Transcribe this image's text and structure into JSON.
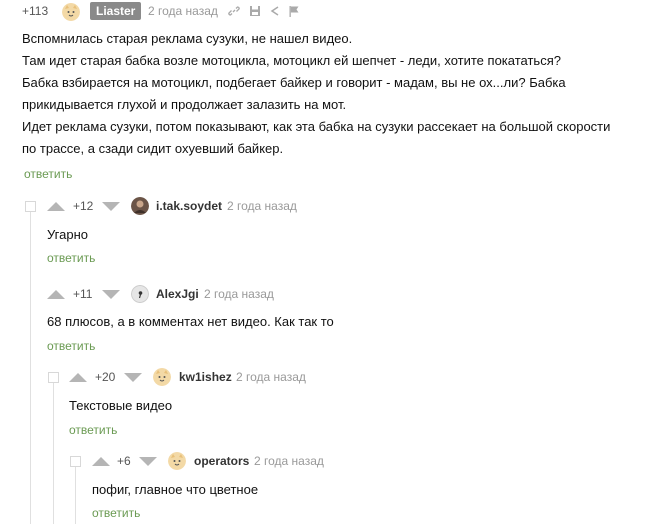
{
  "root": {
    "rating": "+113",
    "author": "Liaster",
    "date": "2 года назад",
    "icons": [
      "link-icon",
      "save-icon",
      "share-icon",
      "flag-icon"
    ],
    "lines": [
      "Вспомнилась старая реклама сузуки, не нашел видео.",
      "Там идет старая бабка возле мотоцикла, мотоцикл ей шепчет - леди, хотите покататься?",
      "Бабка взбирается на мотоцикл, подбегает байкер и говорит -  мадам, вы не ох...ли? Бабка",
      "прикидывается глухой и продолжает залазить на мот.",
      "Идет реклама сузуки, потом показывают, как эта бабка на сузуки рассекает на большой скорости",
      "по трассе, а сзади сидит охуевший байкер."
    ],
    "reply": "ответить"
  },
  "comments": [
    {
      "rating": "+12",
      "author": "i.tak.soydet",
      "date": "2 года назад",
      "text": "Угарно",
      "reply": "ответить",
      "avatar": "photo"
    },
    {
      "rating": "+11",
      "author": "AlexJgi",
      "date": "2 года назад",
      "text": "68 плюсов, а в комментах нет видео. Как так то",
      "reply": "ответить",
      "avatar": "grey"
    },
    {
      "rating": "+20",
      "author": "kw1ishez",
      "date": "2 года назад",
      "text": "Текстовые видео",
      "reply": "ответить",
      "avatar": "cat"
    },
    {
      "rating": "+6",
      "author": "operators",
      "date": "2 года назад",
      "text": "пофиг, главное что цветное",
      "reply": "ответить",
      "avatar": "cat"
    }
  ],
  "colors": {
    "reply": "#6a9a52",
    "badge": "#8a8a8a",
    "arrow": "#b5b5b5"
  }
}
